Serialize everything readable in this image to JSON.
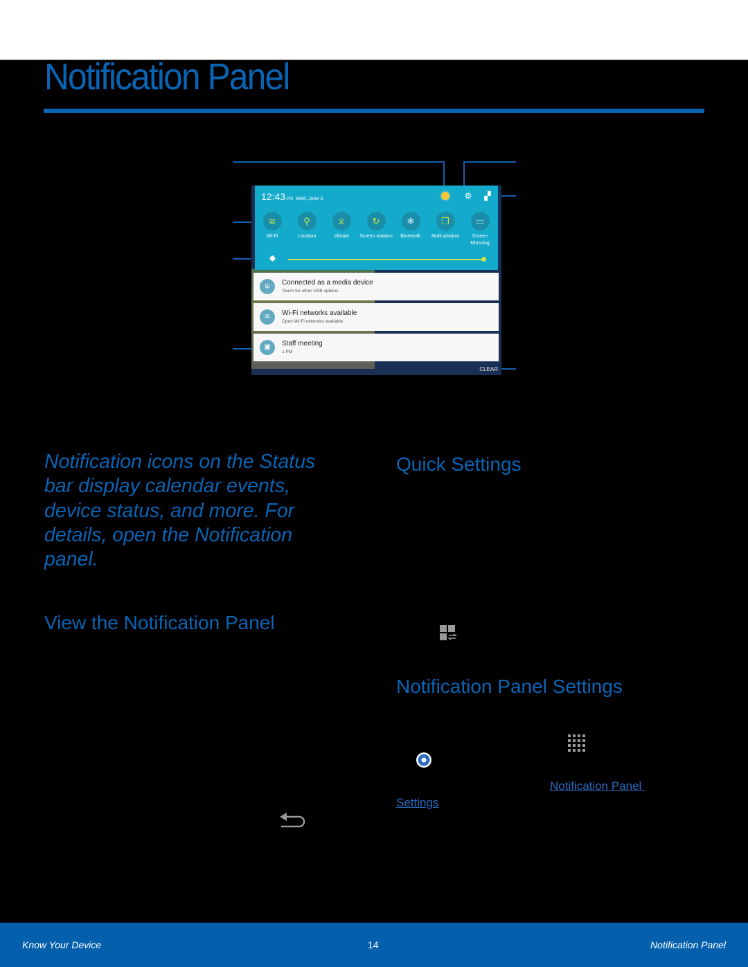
{
  "page": {
    "title": "Notification Panel"
  },
  "figure": {
    "status": {
      "time": "12:43",
      "ampm": "PM",
      "date": "Wed, June 3"
    },
    "header_icons": [
      "bulb-icon",
      "settings-gear-icon",
      "quick-settings-edit-icon"
    ],
    "quick_settings": [
      {
        "label": "Wi-Fi",
        "icon": "wifi-icon",
        "glyph": "≋",
        "on": true
      },
      {
        "label": "Location",
        "icon": "location-pin-icon",
        "glyph": "⚲",
        "on": true
      },
      {
        "label": "Vibrate",
        "icon": "vibrate-icon",
        "glyph": "⧖",
        "on": true
      },
      {
        "label": "Screen rotation",
        "icon": "screen-rotation-icon",
        "glyph": "↻",
        "on": true
      },
      {
        "label": "Bluetooth",
        "icon": "bluetooth-icon",
        "glyph": "✱",
        "on": false
      },
      {
        "label": "Multi window",
        "icon": "multi-window-icon",
        "glyph": "❐",
        "on": true
      },
      {
        "label": "Screen Mirroring",
        "icon": "screen-mirroring-icon",
        "glyph": "▭",
        "on": false
      }
    ],
    "brightness_level": 1.0,
    "notifications": [
      {
        "title": "Connected as a media device",
        "subtitle": "Touch for other USB options.",
        "icon": "usb-icon",
        "glyph": "ψ"
      },
      {
        "title": "Wi-Fi networks available",
        "subtitle": "Open Wi-Fi networks available",
        "icon": "wifi-notification-icon",
        "glyph": "≋"
      },
      {
        "title": "Staff meeting",
        "subtitle": "1 PM",
        "icon": "calendar-icon",
        "glyph": "▣"
      }
    ],
    "clear_label": "CLEAR"
  },
  "intro": "Notification icons on the Status bar display calendar events, device status, and more. For details, open the Notification panel.",
  "sections": {
    "view_heading": "View the Notification Panel",
    "quick_heading": "Quick Settings",
    "settings_heading": "Notification Panel Settings"
  },
  "links": {
    "notification_panel": "Notification Panel ",
    "settings": "Settings"
  },
  "footer": {
    "left": "Know Your Device",
    "page_number": "14",
    "right": "Notification Panel"
  },
  "colors": {
    "accent": "#0a64b4",
    "footer_bg": "#0460ac",
    "quick_settings_bg": "#14aacb"
  }
}
